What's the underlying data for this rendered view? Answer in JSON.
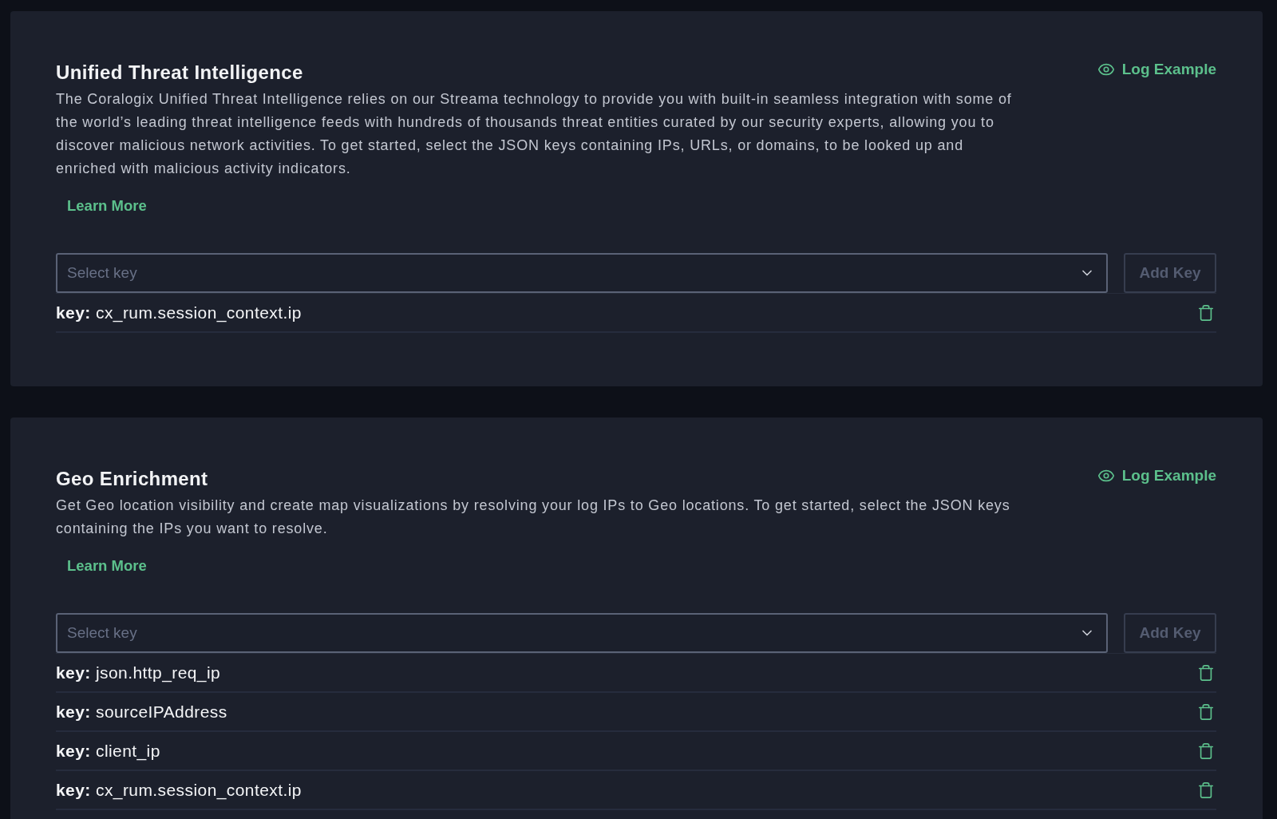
{
  "sections": [
    {
      "title": "Unified Threat Intelligence",
      "log_example_link": "Log Example",
      "description": "The Coralogix Unified Threat Intelligence relies on our Streama technology to provide you with built-in seamless integration with some of the world’s leading threat intelligence feeds with hundreds of thousands threat entities curated by our security experts, allowing you to discover malicious network activities. To get started, select the JSON keys containing IPs, URLs, or domains, to be looked up and enriched with malicious activity indicators.",
      "learn_more_link": "Learn More",
      "key_select": {
        "placeholder": "Select key"
      },
      "add_key_button": {
        "label": "Add Key",
        "disabled": true
      },
      "keys": [
        "**key:** cx_rum.session_context.ip"
      ]
    },
    {
      "title": "Geo Enrichment",
      "log_example_link": "Log Example",
      "description": "Get Geo location visibility and create map visualizations by resolving your log IPs to Geo locations. To get started, select the JSON keys containing the IPs you want to resolve.",
      "learn_more_link": "Learn More",
      "key_select": {
        "placeholder": "Select key"
      },
      "add_key_button": {
        "label": "Add Key",
        "disabled": true
      },
      "keys": [
        "**key:** json.http_req_ip",
        "**key:** sourceIPAddress",
        "**key:** client_ip",
        "**key:** cx_rum.session_context.ip"
      ]
    }
  ]
}
